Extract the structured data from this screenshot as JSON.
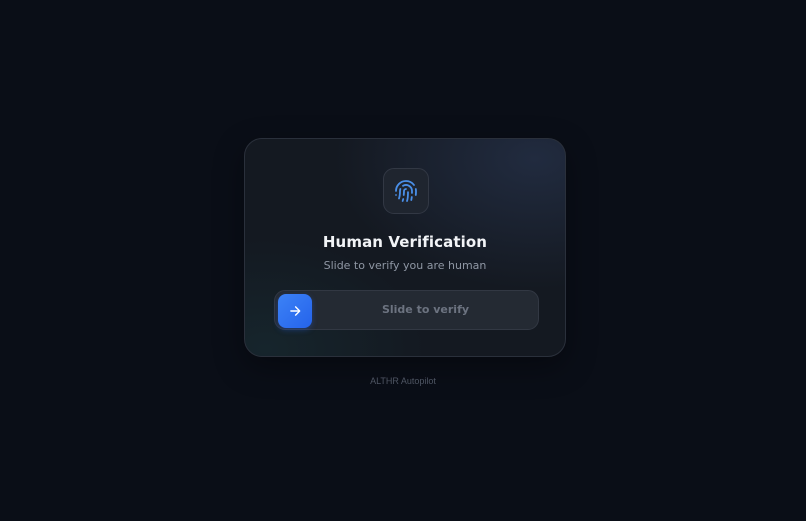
{
  "verification_card": {
    "icon": "fingerprint-icon",
    "title": "Human Verification",
    "subtitle": "Slide to verify you are human",
    "slider": {
      "label": "Slide to verify",
      "handle_icon": "arrow-right-icon",
      "progress": 0
    }
  },
  "footer": {
    "brand": "ALTHR Autopilot"
  },
  "colors": {
    "background": "#0a0e17",
    "card": "#141921",
    "accent": "#3b82f6",
    "fingerprint": "#4a8fe8"
  }
}
